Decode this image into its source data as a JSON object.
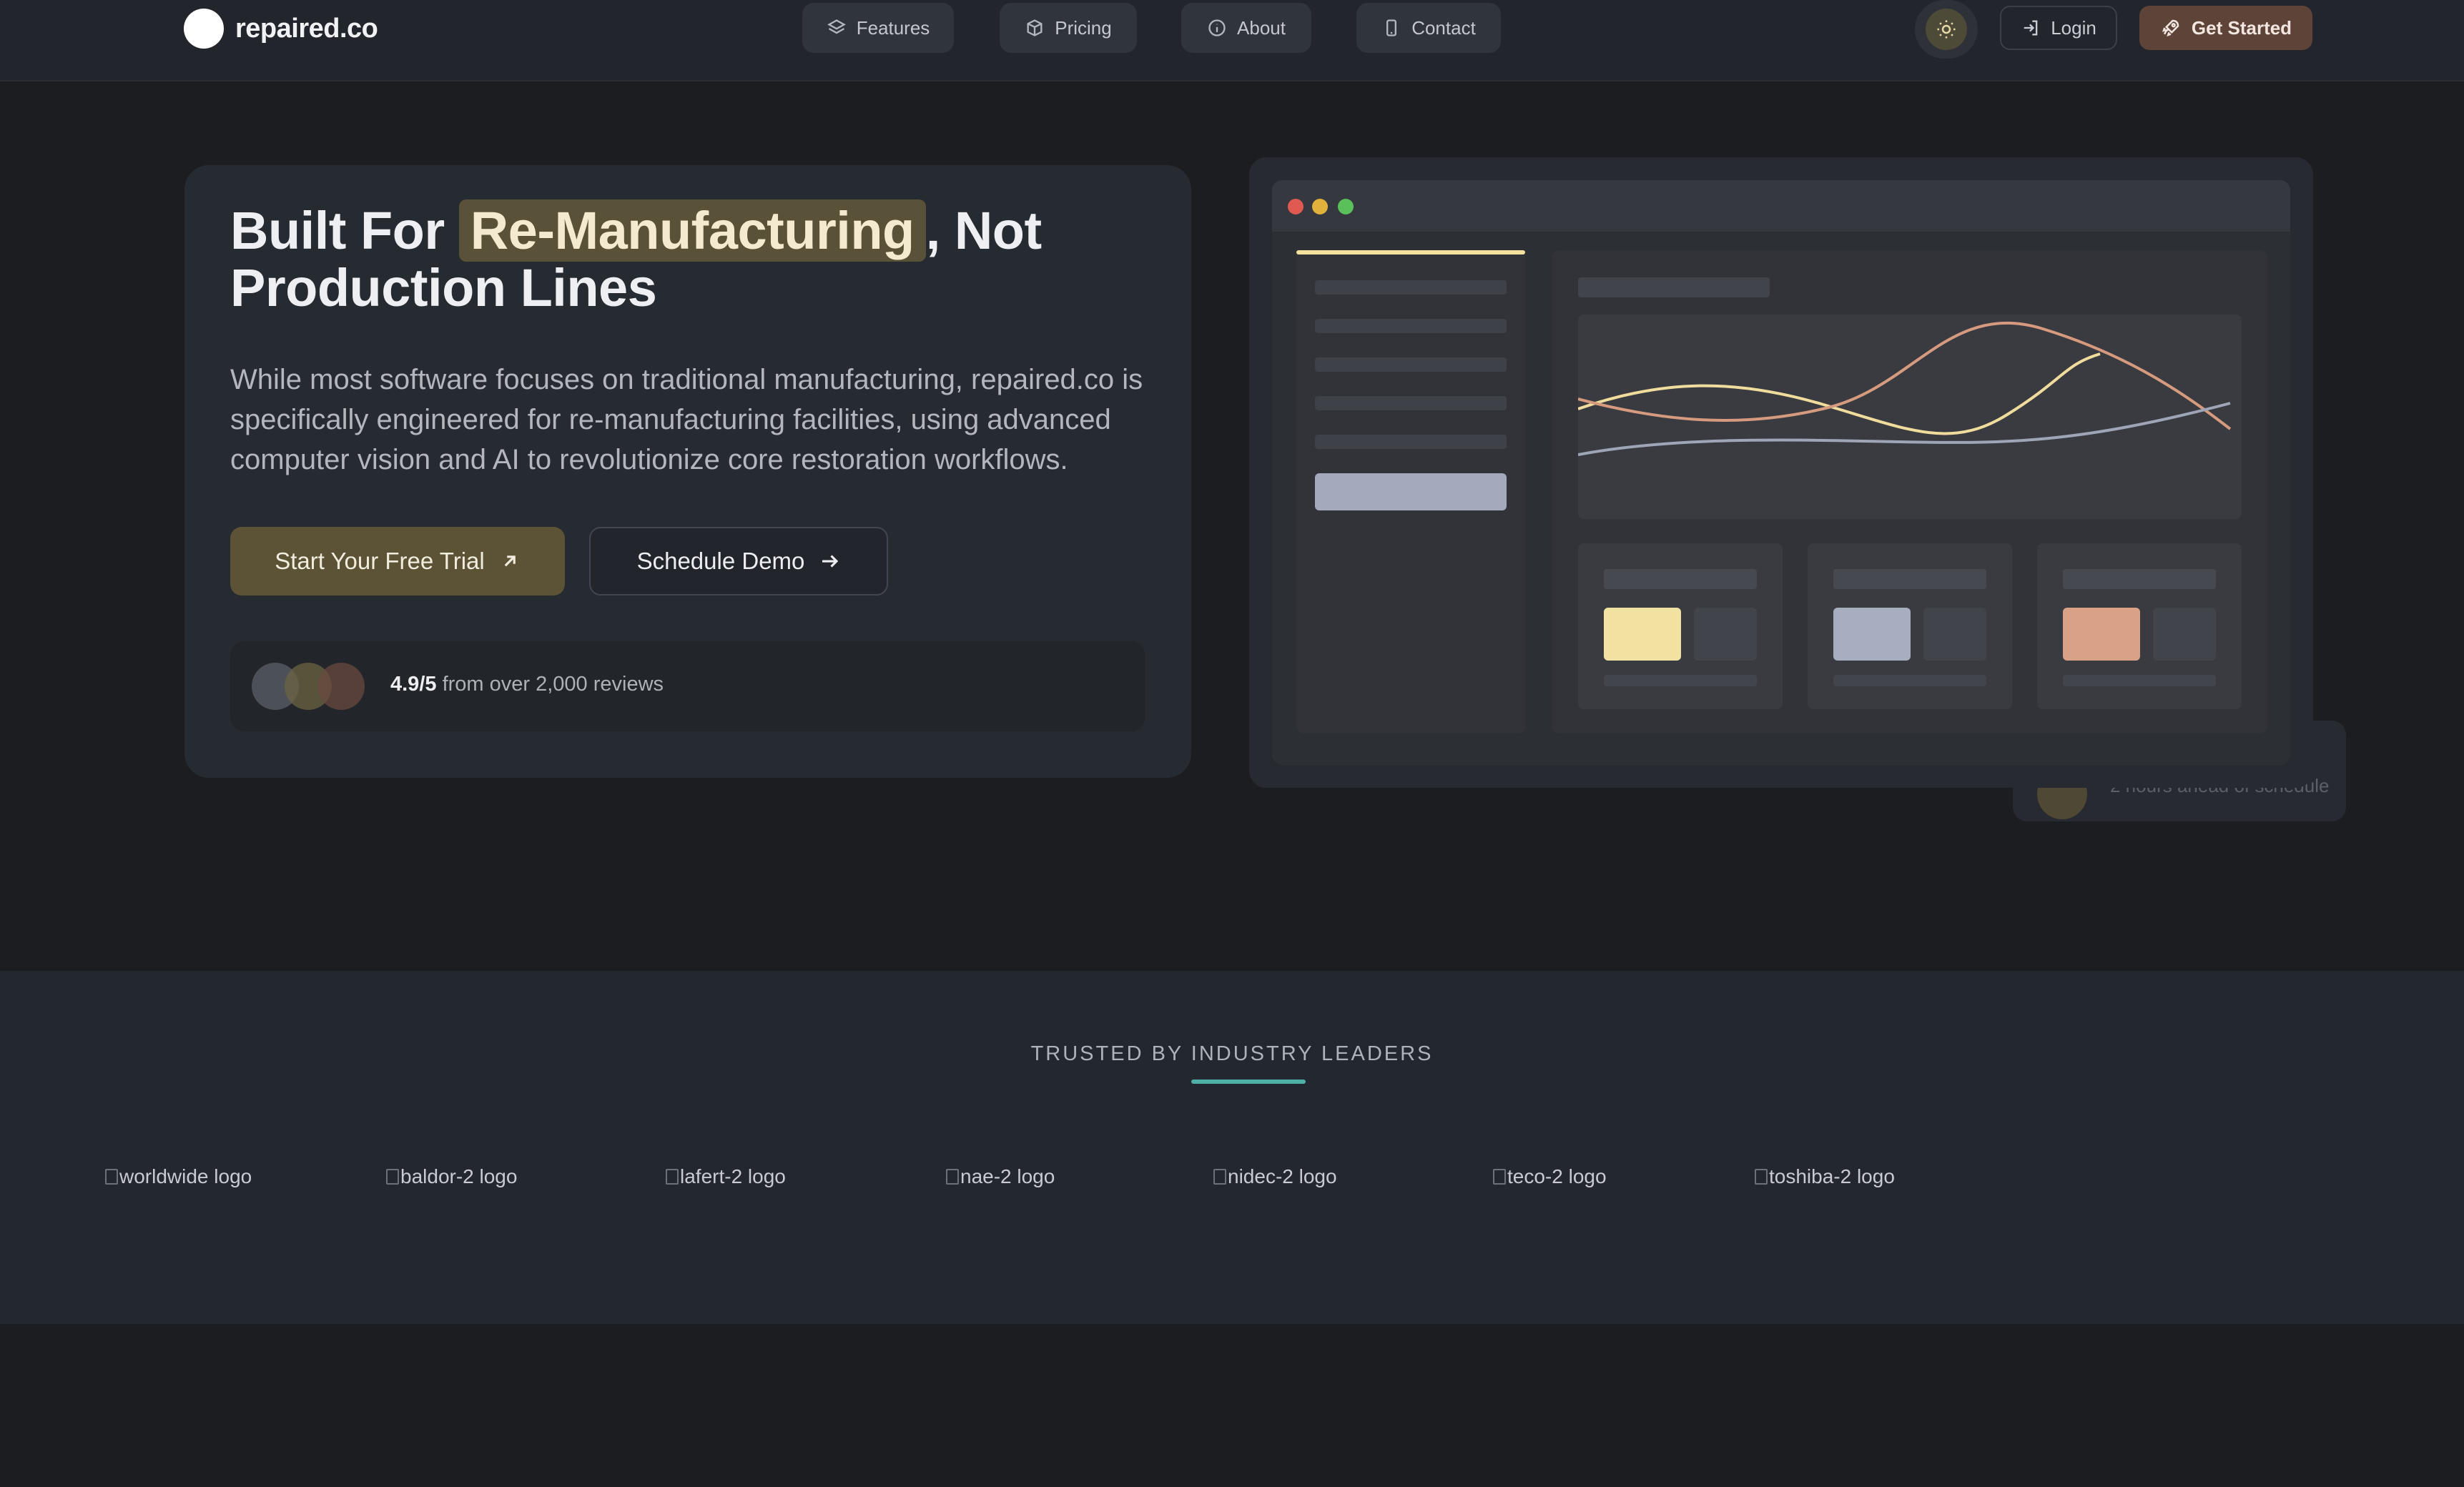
{
  "nav": {
    "brand": "repaired.co",
    "links": [
      {
        "label": "Features",
        "icon": "layers-icon"
      },
      {
        "label": "Pricing",
        "icon": "box-icon"
      },
      {
        "label": "About",
        "icon": "info-icon"
      },
      {
        "label": "Contact",
        "icon": "phone-icon"
      }
    ],
    "theme_toggle_icon": "sun-icon",
    "login_label": "Login",
    "get_started_label": "Get Started"
  },
  "hero": {
    "title_prefix": "Built For",
    "title_highlight": "Re-Manufacturing",
    "title_suffix": ", Not Production Lines",
    "description": "While most software focuses on traditional manufacturing, repaired.co is specifically engineered for re-manufacturing facilities, using advanced computer vision and AI to revolutionize core restoration workflows.",
    "primary_cta": "Start Your Free Trial",
    "secondary_cta": "Schedule Demo",
    "rating": "4.9/5",
    "rating_text": "from over 2,000 reviews"
  },
  "floating_card": {
    "text": "2 hours ahead of schedule"
  },
  "trusted": {
    "title": "TRUSTED BY INDUSTRY LEADERS",
    "logos": [
      "worldwide logo",
      "baldor-2 logo",
      "lafert-2 logo",
      "nae-2 logo",
      "nidec-2 logo",
      "teco-2 logo",
      "toshiba-2 logo"
    ]
  },
  "colors": {
    "background": "#1b1d21",
    "highlight": "#5a5238",
    "accent_teal": "#4fb0a6",
    "swatch_yellow": "#f2e2a2",
    "swatch_blue": "#a7aec0",
    "swatch_peach": "#d9a287"
  }
}
